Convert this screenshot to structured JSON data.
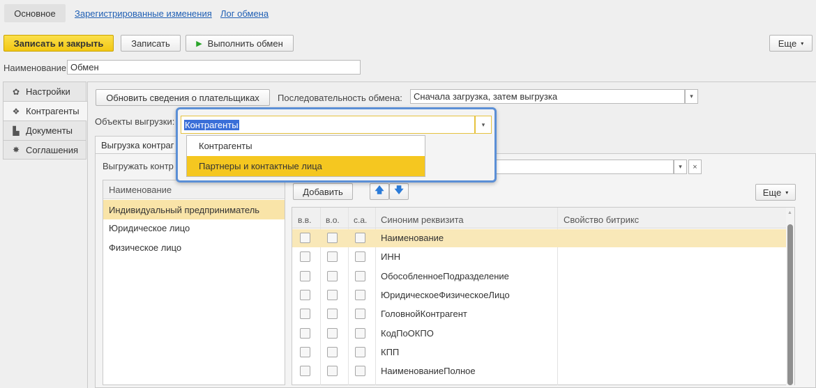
{
  "tabs": {
    "main": "Основное",
    "registered": "Зарегистрированные изменения",
    "log": "Лог обмена"
  },
  "toolbar": {
    "save_close": "Записать и закрыть",
    "save": "Записать",
    "run_exchange": "Выполнить обмен",
    "more": "Еще"
  },
  "name_field": {
    "label": "Наименование:",
    "value": "Обмен"
  },
  "sidebar": {
    "items": [
      {
        "label": "Настройки",
        "icon": "gear-icon"
      },
      {
        "label": "Контрагенты",
        "icon": "people-icon"
      },
      {
        "label": "Документы",
        "icon": "document-icon"
      },
      {
        "label": "Соглашения",
        "icon": "handshake-icon"
      }
    ]
  },
  "panel": {
    "update_payers": "Обновить сведения о плательщиках",
    "sequence_label": "Последовательность обмена:",
    "sequence_value": "Сначала загрузка, затем выгрузка",
    "export_objects_label": "Объекты выгрузки:",
    "export_tab": "Выгрузка контраг",
    "export_kontr_label": "Выгружать контр"
  },
  "dropdown": {
    "selected": "Контрагенты",
    "options": [
      "Контрагенты",
      "Партнеры и контактные лица"
    ]
  },
  "left_list": {
    "header": "Наименование",
    "items": [
      "Индивидуальный предприниматель",
      "Юридическое лицо",
      "Физическое лицо"
    ]
  },
  "right_table": {
    "add": "Добавить",
    "more": "Еще",
    "columns": [
      "в.в.",
      "в.о.",
      "с.а.",
      "Синоним реквизита",
      "Свойство битрикс"
    ],
    "rows": [
      "Наименование",
      "ИНН",
      "ОбособленноеПодразделение",
      "ЮридическоеФизическоеЛицо",
      "ГоловнойКонтрагент",
      "КодПоОКПО",
      "КПП",
      "НаименованиеПолное"
    ]
  }
}
